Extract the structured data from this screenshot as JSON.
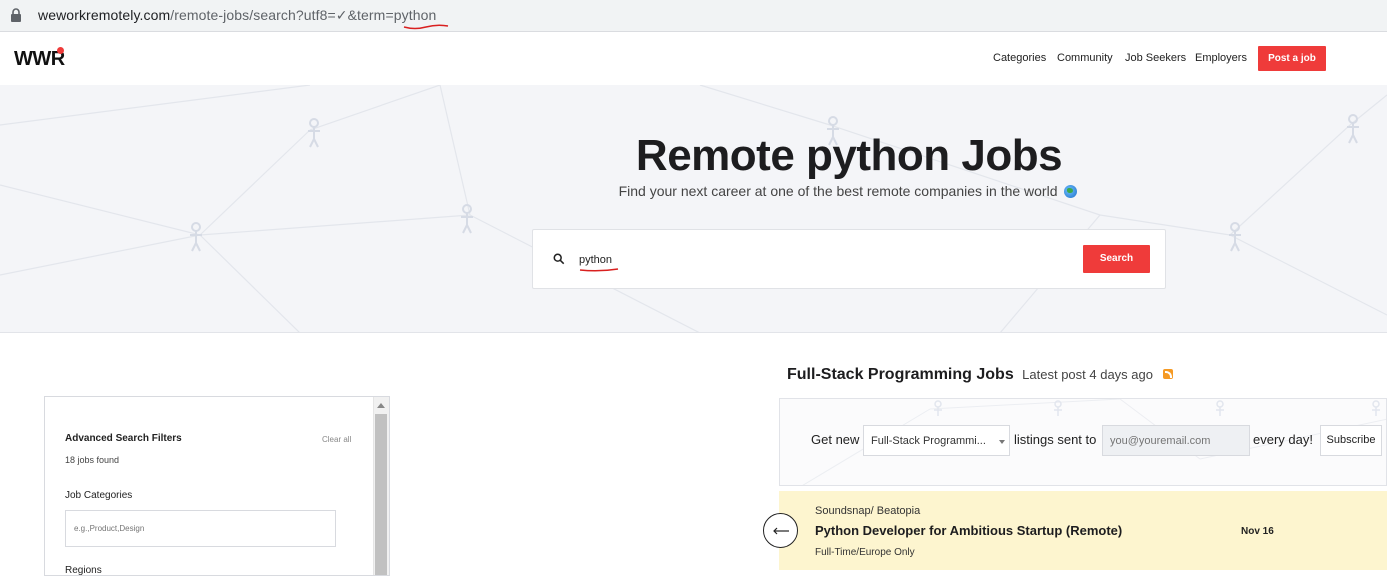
{
  "browser": {
    "url_host": "weworkremotely.com",
    "url_path": "/remote-jobs/search?utf8=✓&term=python"
  },
  "header": {
    "logo": "WWR",
    "nav": [
      "Categories",
      "Community",
      "Job Seekers",
      "Employers"
    ],
    "post_job": "Post a job",
    "accent_color": "#ef3b3a"
  },
  "hero": {
    "title": "Remote python Jobs",
    "subtitle": "Find your next career at one of the best remote companies in the world",
    "search_value": "python",
    "search_button": "Search"
  },
  "filters": {
    "title": "Advanced Search Filters",
    "clear": "Clear all",
    "count": "18 jobs found",
    "categories_label": "Job Categories",
    "categories_placeholder": "e.g.,Product,Design",
    "next_label": "Regions"
  },
  "section": {
    "title": "Full-Stack Programming Jobs",
    "meta": "Latest post 4 days ago"
  },
  "subscribe": {
    "prefix": "Get new",
    "category": "Full-Stack Programmi...",
    "middle": "listings sent to",
    "email_placeholder": "you@youremail.com",
    "suffix": "every day!",
    "button": "Subscribe"
  },
  "jobs": [
    {
      "company": "Soundsnap/ Beatopia",
      "title": "Python Developer for Ambitious Startup (Remote)",
      "type": "Full-Time/Europe Only",
      "date": "Nov 16"
    }
  ]
}
